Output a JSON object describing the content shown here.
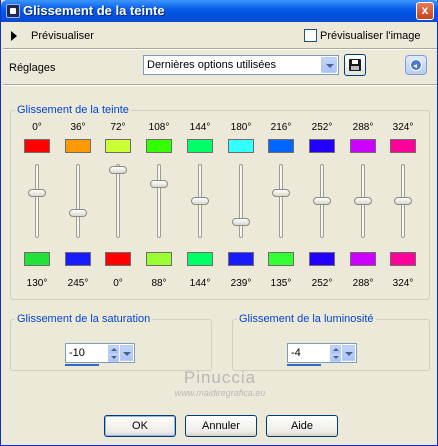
{
  "window": {
    "title": "Glissement de la teinte",
    "close_glyph": "x"
  },
  "preview": {
    "label": "Prévisualiser",
    "checkbox_label": "Prévisualiser l'image",
    "checked": false
  },
  "presets": {
    "label": "Réglages",
    "value": "Dernières options utilisées"
  },
  "hue_shift": {
    "title": "Glissement de la teinte",
    "channels": [
      {
        "from": "0°",
        "from_color": "#ff0000",
        "to": "130°",
        "to_color": "#22e23a",
        "level": 0.62
      },
      {
        "from": "36°",
        "from_color": "#ff9900",
        "to": "245°",
        "to_color": "#1a1aff",
        "level": 0.32
      },
      {
        "from": "72°",
        "from_color": "#ccff33",
        "to": "0°",
        "to_color": "#ff0000",
        "level": 0.97
      },
      {
        "from": "108°",
        "from_color": "#33ff00",
        "to": "88°",
        "to_color": "#99ff33",
        "level": 0.76
      },
      {
        "from": "144°",
        "from_color": "#00ff66",
        "to": "144°",
        "to_color": "#00ff66",
        "level": 0.5
      },
      {
        "from": "180°",
        "from_color": "#33ffff",
        "to": "239°",
        "to_color": "#1a1aff",
        "level": 0.18
      },
      {
        "from": "216°",
        "from_color": "#0066ff",
        "to": "135°",
        "to_color": "#33ff33",
        "level": 0.62
      },
      {
        "from": "252°",
        "from_color": "#2200ff",
        "to": "252°",
        "to_color": "#2200ff",
        "level": 0.5
      },
      {
        "from": "288°",
        "from_color": "#cc00ff",
        "to": "288°",
        "to_color": "#cc00ff",
        "level": 0.5
      },
      {
        "from": "324°",
        "from_color": "#ff0099",
        "to": "324°",
        "to_color": "#ff0099",
        "level": 0.5
      }
    ]
  },
  "saturation": {
    "title": "Glissement de la saturation",
    "value": "-10"
  },
  "luminosity": {
    "title": "Glissement de la luminosité",
    "value": "-4"
  },
  "watermark": {
    "name": "Pinuccia",
    "site": "www.maidiregrafica.eu"
  },
  "buttons": {
    "ok": "OK",
    "cancel": "Annuler",
    "help": "Aide"
  }
}
